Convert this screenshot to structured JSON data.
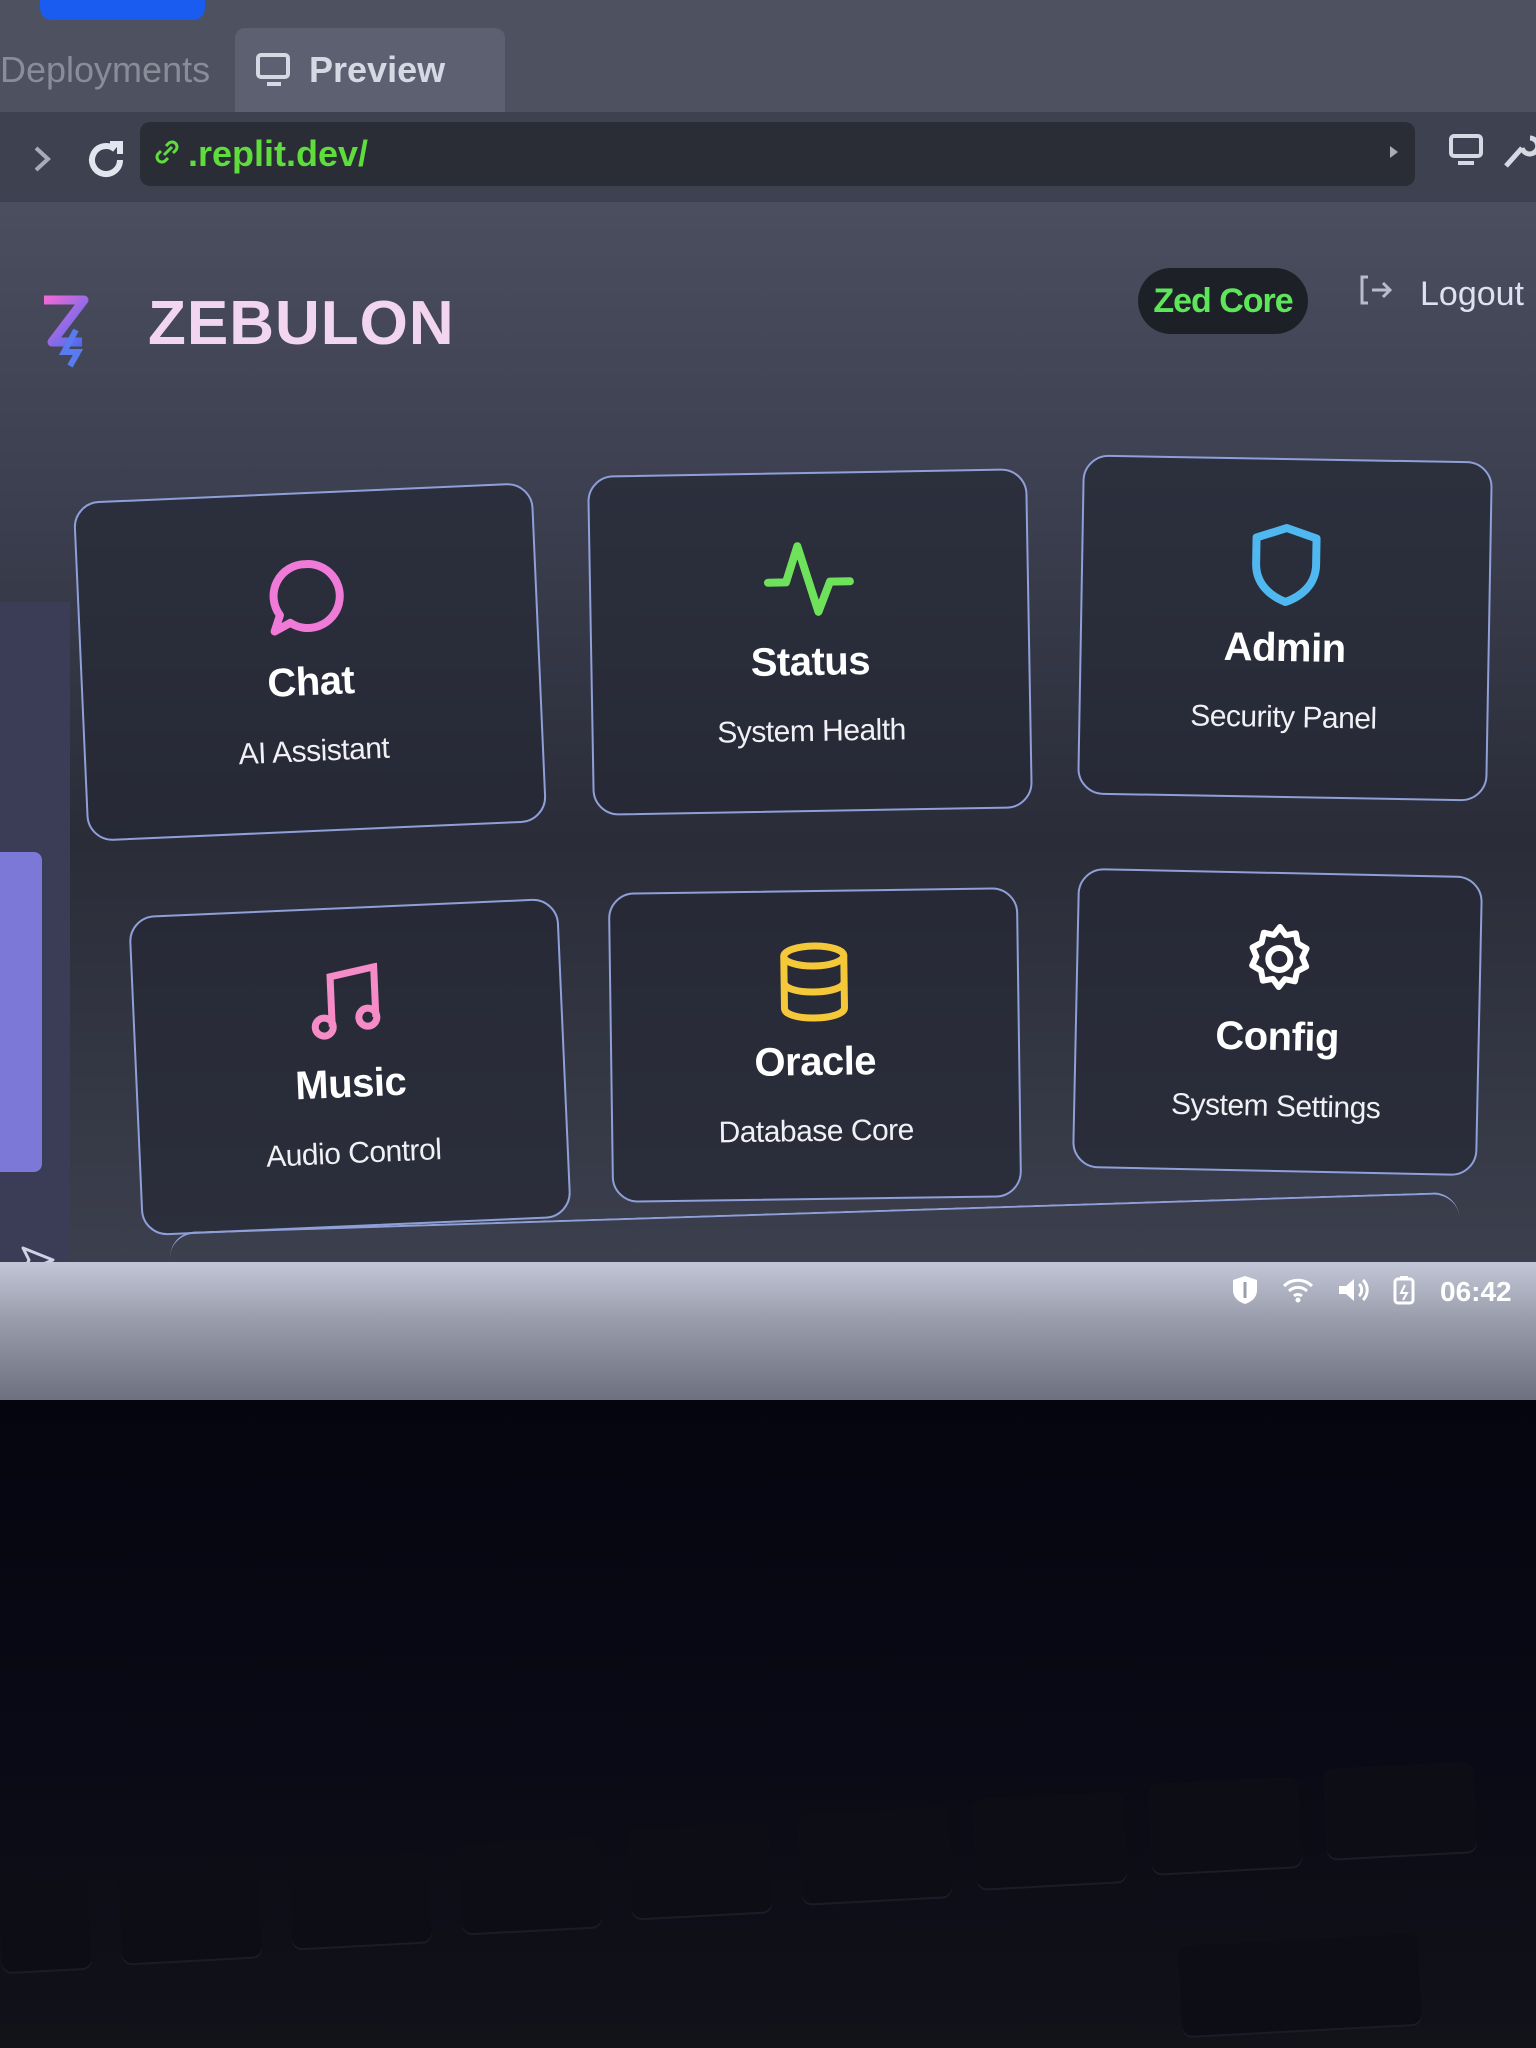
{
  "browser": {
    "tabs": [
      {
        "label": "Deployments",
        "active": false
      },
      {
        "label": "Preview",
        "active": true
      }
    ],
    "url": ".replit.dev/"
  },
  "app": {
    "brand": "ZEBULON",
    "badge": "Zed Core",
    "logout_label": "Logout",
    "cards": [
      {
        "title": "Chat",
        "subtitle": "AI Assistant",
        "icon": "chat-bubble-icon",
        "color": "#f07ad8"
      },
      {
        "title": "Status",
        "subtitle": "System Health",
        "icon": "pulse-icon",
        "color": "#6ee25a"
      },
      {
        "title": "Admin",
        "subtitle": "Security Panel",
        "icon": "shield-icon",
        "color": "#4fb8f0"
      },
      {
        "title": "Music",
        "subtitle": "Audio Control",
        "icon": "music-note-icon",
        "color": "#f58cc8"
      },
      {
        "title": "Oracle",
        "subtitle": "Database Core",
        "icon": "database-icon",
        "color": "#f5c83a"
      },
      {
        "title": "Config",
        "subtitle": "System Settings",
        "icon": "gear-icon",
        "color": "#ffffff"
      }
    ]
  },
  "taskbar": {
    "clock": "06:42",
    "tray_icons": [
      "shield-icon",
      "wifi-icon",
      "volume-icon",
      "battery-icon"
    ]
  },
  "colors": {
    "accent_green": "#5ee65a",
    "card_border": "#8f9fd8",
    "brand_text": "#f2d6f0"
  }
}
